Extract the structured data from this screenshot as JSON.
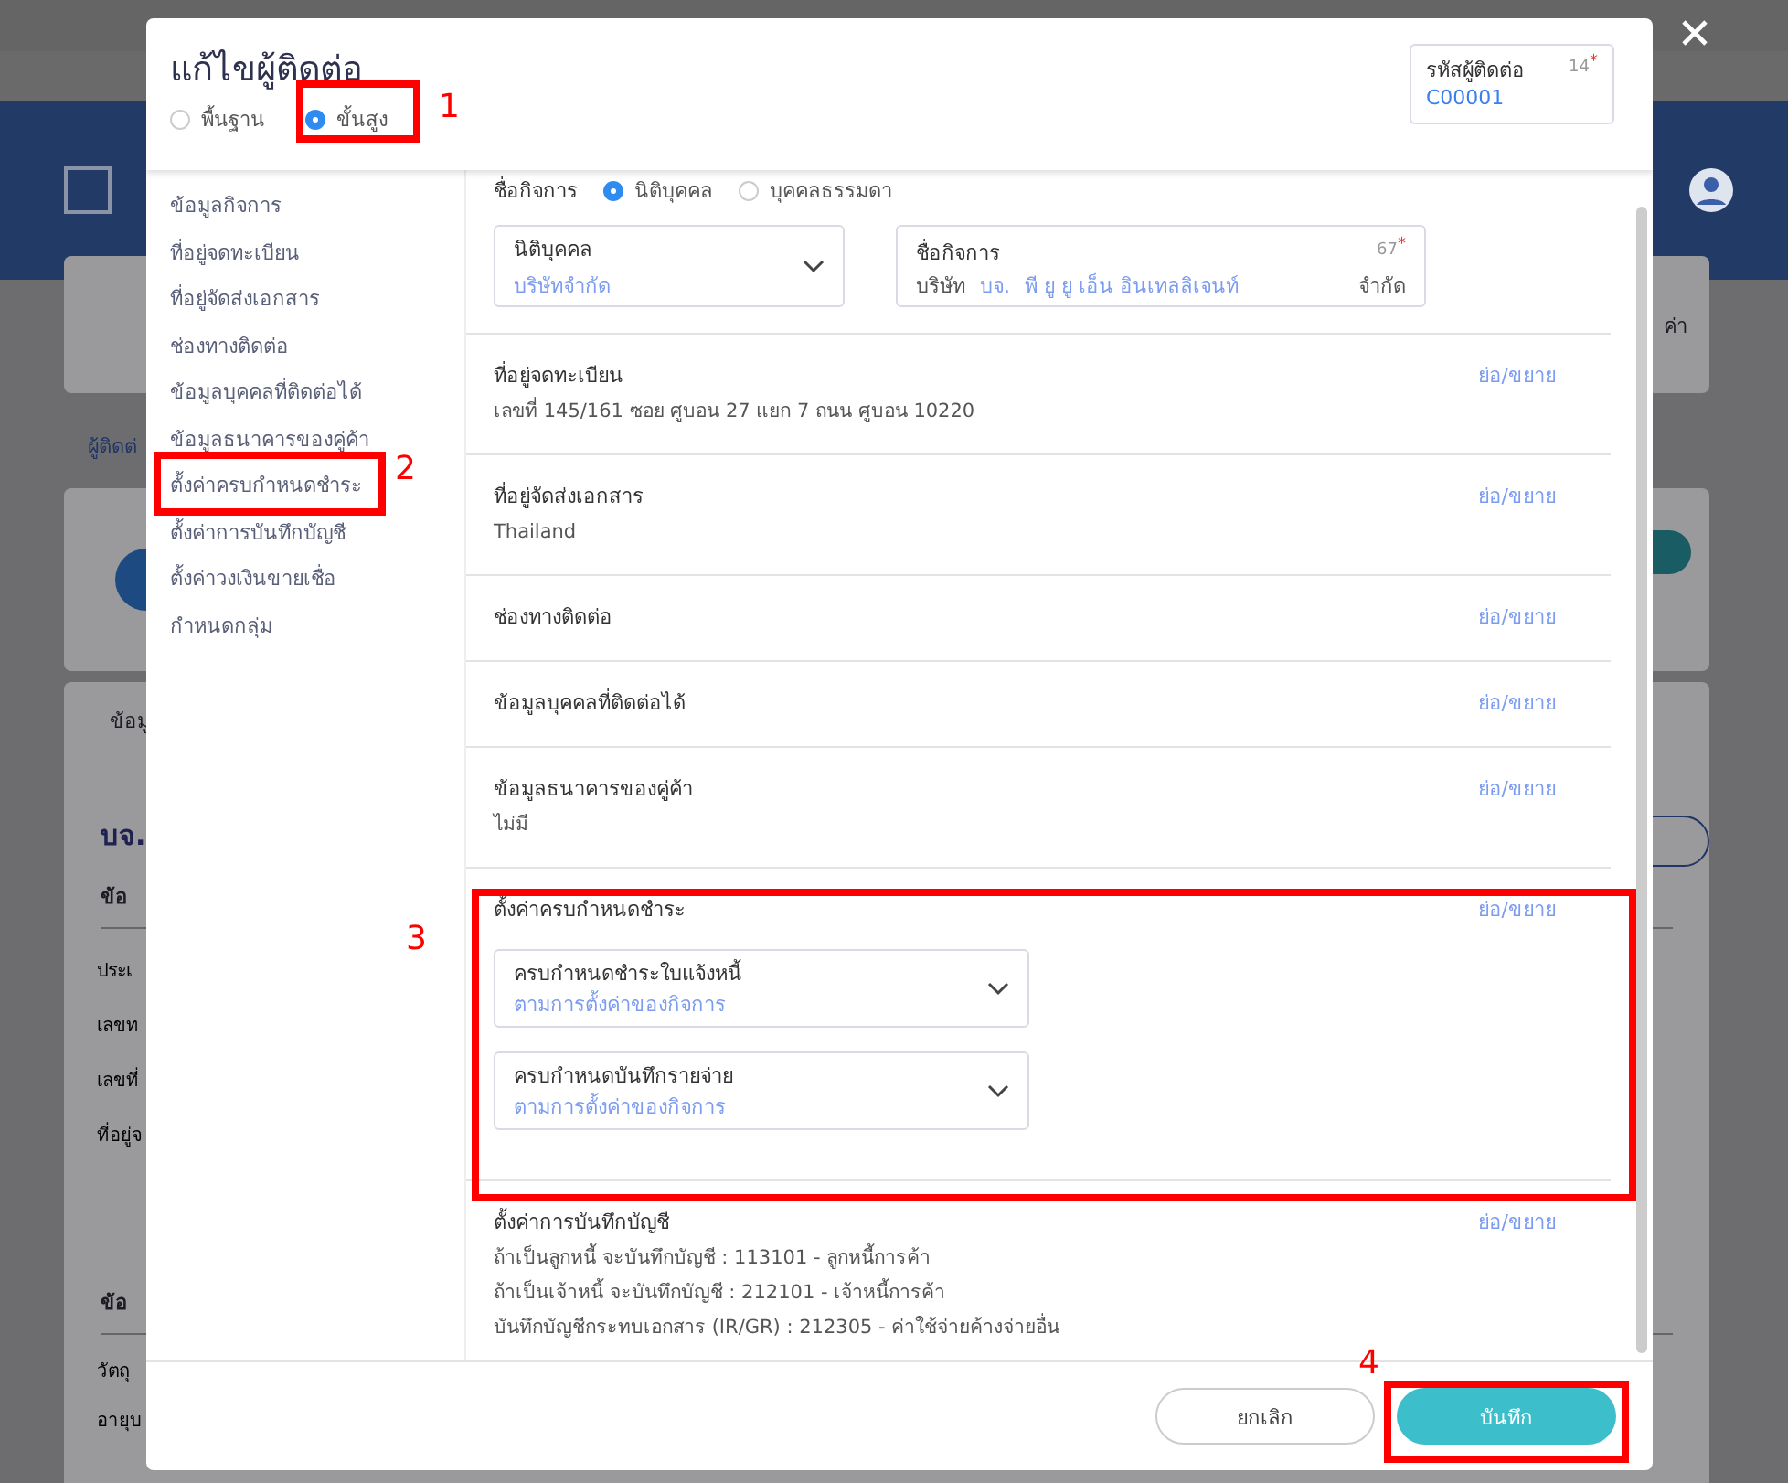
{
  "background": {
    "link": "ผู้ติดต่",
    "tab": "ข้อมู",
    "company": "บจ.",
    "right_text": "ค่า",
    "groups": [
      {
        "heading": "ข้อ",
        "rows": [
          "ประเ",
          "เลขท",
          "เลขที่",
          "ที่อยู่จ"
        ]
      },
      {
        "heading": "ข้อ",
        "rows": [
          "วัตถุ",
          "อายุบ"
        ]
      }
    ]
  },
  "modal": {
    "title": "แก้ไขผู้ติดต่อ",
    "modes": [
      {
        "label": "พื้นฐาน",
        "selected": false
      },
      {
        "label": "ขั้นสูง",
        "selected": true
      }
    ],
    "contact_code": {
      "label": "รหัสผู้ติดต่อ",
      "counter": "14",
      "required_mark": "*",
      "value": "C00001"
    }
  },
  "nav": [
    {
      "label": "ข้อมูลกิจการ"
    },
    {
      "label": "ที่อยู่จดทะเบียน"
    },
    {
      "label": "ที่อยู่จัดส่งเอกสาร"
    },
    {
      "label": "ช่องทางติดต่อ"
    },
    {
      "label": "ข้อมูลบุคคลที่ติดต่อได้"
    },
    {
      "label": "ข้อมูลธนาคารของคู่ค้า"
    },
    {
      "label": "ตั้งค่าครบกำหนดชำระ"
    },
    {
      "label": "ตั้งค่าการบันทึกบัญชี"
    },
    {
      "label": "ตั้งค่าวงเงินขายเชื่อ"
    },
    {
      "label": "กำหนดกลุ่ม"
    }
  ],
  "business": {
    "label": "ชื่อกิจการ",
    "types": [
      {
        "label": "นิติบุคคล",
        "selected": true
      },
      {
        "label": "บุคคลธรรมดา",
        "selected": false
      }
    ],
    "entity_field": {
      "label": "นิติบุคคล",
      "value": "บริษัทจำกัด"
    },
    "name_field": {
      "label": "ชื่อกิจการ",
      "counter": "67",
      "required_mark": "*",
      "prefix": "บริษัท",
      "abbreviation": "บจ.",
      "value": "พี ยู ยู เอ็น อินเทลลิเจนท์",
      "suffix": "จำกัด"
    }
  },
  "sections": [
    {
      "title": "ที่อยู่จดทะเบียน",
      "toggle": "ย่อ/ขยาย",
      "lines": [
        "เลขที่ 145/161 ซอย ศูบอน 27 แยก 7 ถนน ศูบอน 10220"
      ]
    },
    {
      "title": "ที่อยู่จัดส่งเอกสาร",
      "toggle": "ย่อ/ขยาย",
      "lines": [
        "Thailand"
      ]
    },
    {
      "title": "ช่องทางติดต่อ",
      "toggle": "ย่อ/ขยาย"
    },
    {
      "title": "ข้อมูลบุคคลที่ติดต่อได้",
      "toggle": "ย่อ/ขยาย"
    },
    {
      "title": "ข้อมูลธนาคารของคู่ค้า",
      "toggle": "ย่อ/ขยาย",
      "lines": [
        "ไม่มี"
      ]
    },
    {
      "title": "ตั้งค่าครบกำหนดชำระ",
      "toggle": "ย่อ/ขยาย",
      "selects": [
        {
          "label": "ครบกำหนดชำระใบแจ้งหนี้",
          "value": "ตามการตั้งค่าของกิจการ"
        },
        {
          "label": "ครบกำหนดบันทึกรายจ่าย",
          "value": "ตามการตั้งค่าของกิจการ"
        }
      ]
    },
    {
      "title": "ตั้งค่าการบันทึกบัญชี",
      "toggle": "ย่อ/ขยาย",
      "lines": [
        "ถ้าเป็นลูกหนี้ จะบันทึกบัญชี : 113101 - ลูกหนี้การค้า",
        "ถ้าเป็นเจ้าหนี้ จะบันทึกบัญชี : 212101 - เจ้าหนี้การค้า",
        "บันทึกบัญชีกระทบเอกสาร (IR/GR) : 212305 - ค่าใช้จ่ายค้างจ่ายอื่น"
      ]
    }
  ],
  "buttons": {
    "cancel": "ยกเลิก",
    "save": "บันทึก"
  },
  "annotations": [
    "1",
    "2",
    "3",
    "4"
  ]
}
